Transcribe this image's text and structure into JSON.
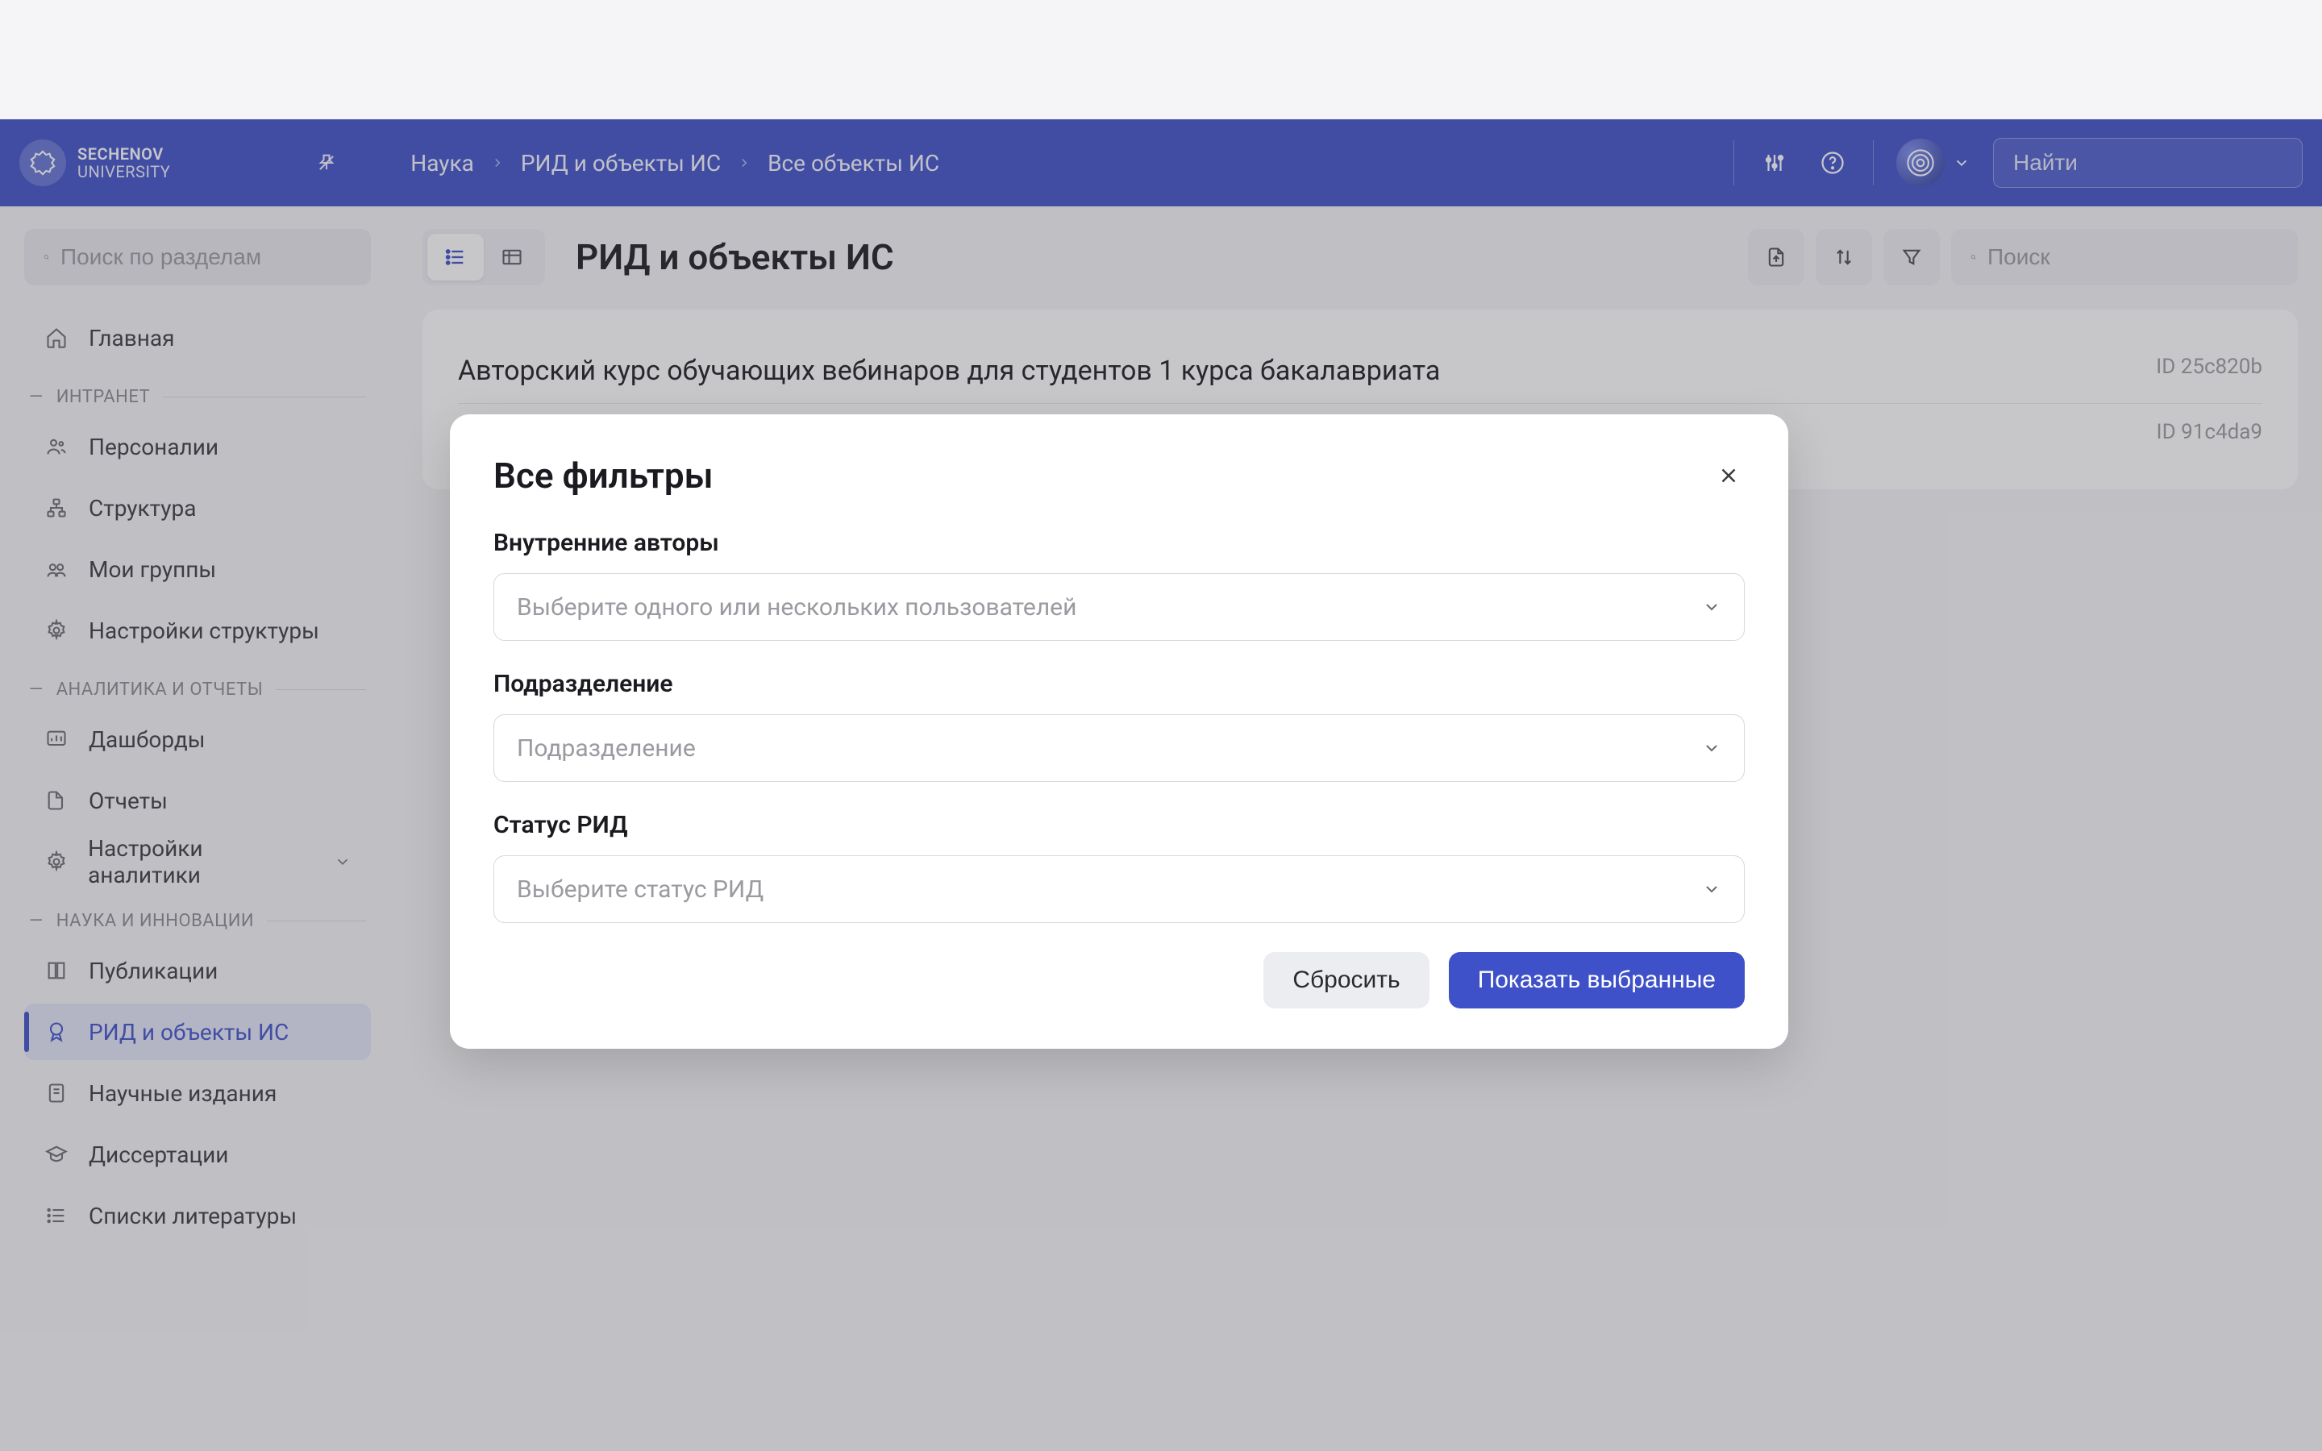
{
  "brand": {
    "line1": "SECHENOV",
    "line2": "UNIVERSITY"
  },
  "breadcrumb": {
    "item1": "Наука",
    "item2": "РИД и объекты ИС",
    "item3": "Все объекты ИС"
  },
  "header": {
    "search_placeholder": "Найти"
  },
  "sidebar": {
    "search_placeholder": "Поиск по разделам",
    "home": "Главная",
    "section_intranet": "ИНТРАНЕТ",
    "personas": "Персоналии",
    "structure": "Структура",
    "my_groups": "Мои группы",
    "structure_settings": "Настройки структуры",
    "section_analytics": "АНАЛИТИКА И ОТЧЕТЫ",
    "dashboards": "Дашборды",
    "reports": "Отчеты",
    "analytics_settings": "Настройки аналитики",
    "section_science": "НАУКА И ИННОВАЦИИ",
    "publications": "Публикации",
    "rid": "РИД и объекты ИС",
    "journals": "Научные издания",
    "dissertations": "Диссертации",
    "bibliography": "Списки литературы"
  },
  "main": {
    "title": "РИД и объекты ИС",
    "search_placeholder": "Поиск",
    "rows": [
      {
        "title": "Авторский курс обучающих вебинаров для студентов 1 курса бакалавриата",
        "id": "ID 25c820b"
      },
      {
        "title": "",
        "id": "ID 91c4da9"
      }
    ]
  },
  "modal": {
    "title": "Все фильтры",
    "filters": [
      {
        "label": "Внутренние авторы",
        "placeholder": "Выберите одного или нескольких пользователей"
      },
      {
        "label": "Подразделение",
        "placeholder": "Подразделение"
      },
      {
        "label": "Статус РИД",
        "placeholder": "Выберите статус РИД"
      }
    ],
    "reset": "Сбросить",
    "apply": "Показать выбранные"
  }
}
